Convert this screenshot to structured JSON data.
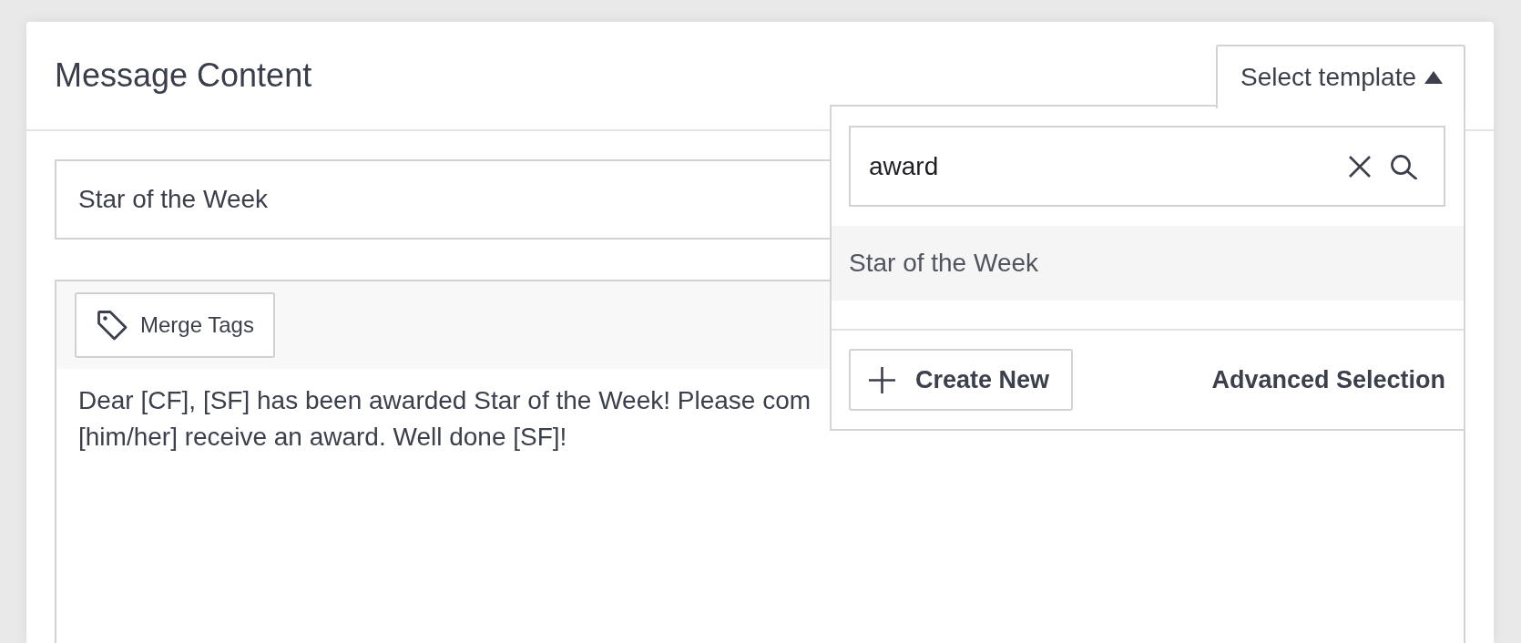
{
  "card": {
    "title": "Message Content"
  },
  "template_select": {
    "label": "Select template",
    "expanded": true,
    "search": {
      "value": "award"
    },
    "options": [
      {
        "label": "Star of the Week",
        "selected": true
      }
    ],
    "create_button": "Create New",
    "advanced_link": "Advanced Selection"
  },
  "subject": {
    "value": "Star of the Week"
  },
  "editor": {
    "merge_tags_button": "Merge Tags",
    "body_lines": [
      "Dear [CF], [SF] has been awarded Star of the Week! Please com",
      "[him/her] receive an award. Well done [SF]!"
    ]
  }
}
